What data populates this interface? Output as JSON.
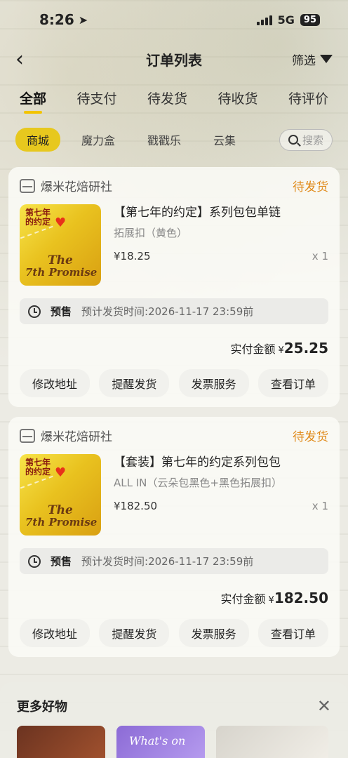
{
  "status_bar": {
    "time": "8:26",
    "network": "5G",
    "battery": "95"
  },
  "nav": {
    "title": "订单列表",
    "filter_label": "筛选"
  },
  "tabs": [
    "全部",
    "待支付",
    "待发货",
    "待收货",
    "待评价"
  ],
  "subtabs": [
    "商城",
    "魔力盒",
    "戳戳乐",
    "云集"
  ],
  "search": {
    "placeholder": "搜索"
  },
  "orders": [
    {
      "shop": "爆米花焙研社",
      "status": "待发货",
      "title": "【第七年的约定】系列包包单链",
      "spec": "拓展扣（黄色）",
      "price": "¥18.25",
      "qty": "x 1",
      "thumb_corner": "第七年\n的约定",
      "thumb_text_1": "The",
      "thumb_text_2": "7th Promise",
      "presale_label": "预售",
      "presale_time": "预计发货时间:2026-11-17 23:59前",
      "total_label": "实付金额",
      "total_symbol": "¥",
      "total_amount": "25.25",
      "actions": [
        "修改地址",
        "提醒发货",
        "发票服务",
        "查看订单"
      ]
    },
    {
      "shop": "爆米花焙研社",
      "status": "待发货",
      "title": "【套装】第七年的约定系列包包",
      "spec": "ALL IN（云朵包黑色+黑色拓展扣）",
      "price": "¥182.50",
      "qty": "x 1",
      "thumb_corner": "第七年\n的约定",
      "thumb_text_1": "The",
      "thumb_text_2": "7th Promise",
      "presale_label": "预售",
      "presale_time": "预计发货时间:2026-11-17 23:59前",
      "total_label": "实付金额",
      "total_symbol": "¥",
      "total_amount": "182.50",
      "actions": [
        "修改地址",
        "提醒发货",
        "发票服务",
        "查看订单"
      ]
    }
  ],
  "more": {
    "title": "更多好物",
    "item2_text": "What's on"
  },
  "colors": {
    "accent": "#e7c81e",
    "status": "#e08a1a"
  }
}
